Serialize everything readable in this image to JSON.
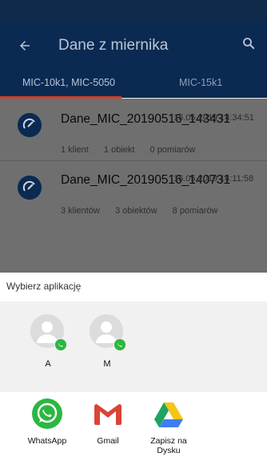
{
  "appbar": {
    "title": "Dane z miernika"
  },
  "tabs": [
    {
      "label": "MIC-10k1, MIC-5050"
    },
    {
      "label": "MIC-15k1"
    }
  ],
  "files": [
    {
      "name": "Dane_MIC_20190516_143431",
      "date": "16.05.2019 14:34:51",
      "meta": [
        "1 klient",
        "1 obiekt",
        "0 pomiarów"
      ]
    },
    {
      "name": "Dane_MIC_20190516_140731",
      "date": "16.05.2019 14:11:58",
      "meta": [
        "3 klientów",
        "3 obiektów",
        "8 pomiarów"
      ]
    }
  ],
  "share": {
    "title": "Wybierz aplikację",
    "contacts": [
      {
        "label": "A"
      },
      {
        "label": "M"
      }
    ],
    "apps": [
      {
        "label": "WhatsApp",
        "icon": "whatsapp-icon"
      },
      {
        "label": "Gmail",
        "icon": "gmail-icon"
      },
      {
        "label": "Zapisz na Dysku",
        "icon": "google-drive-icon"
      }
    ]
  }
}
